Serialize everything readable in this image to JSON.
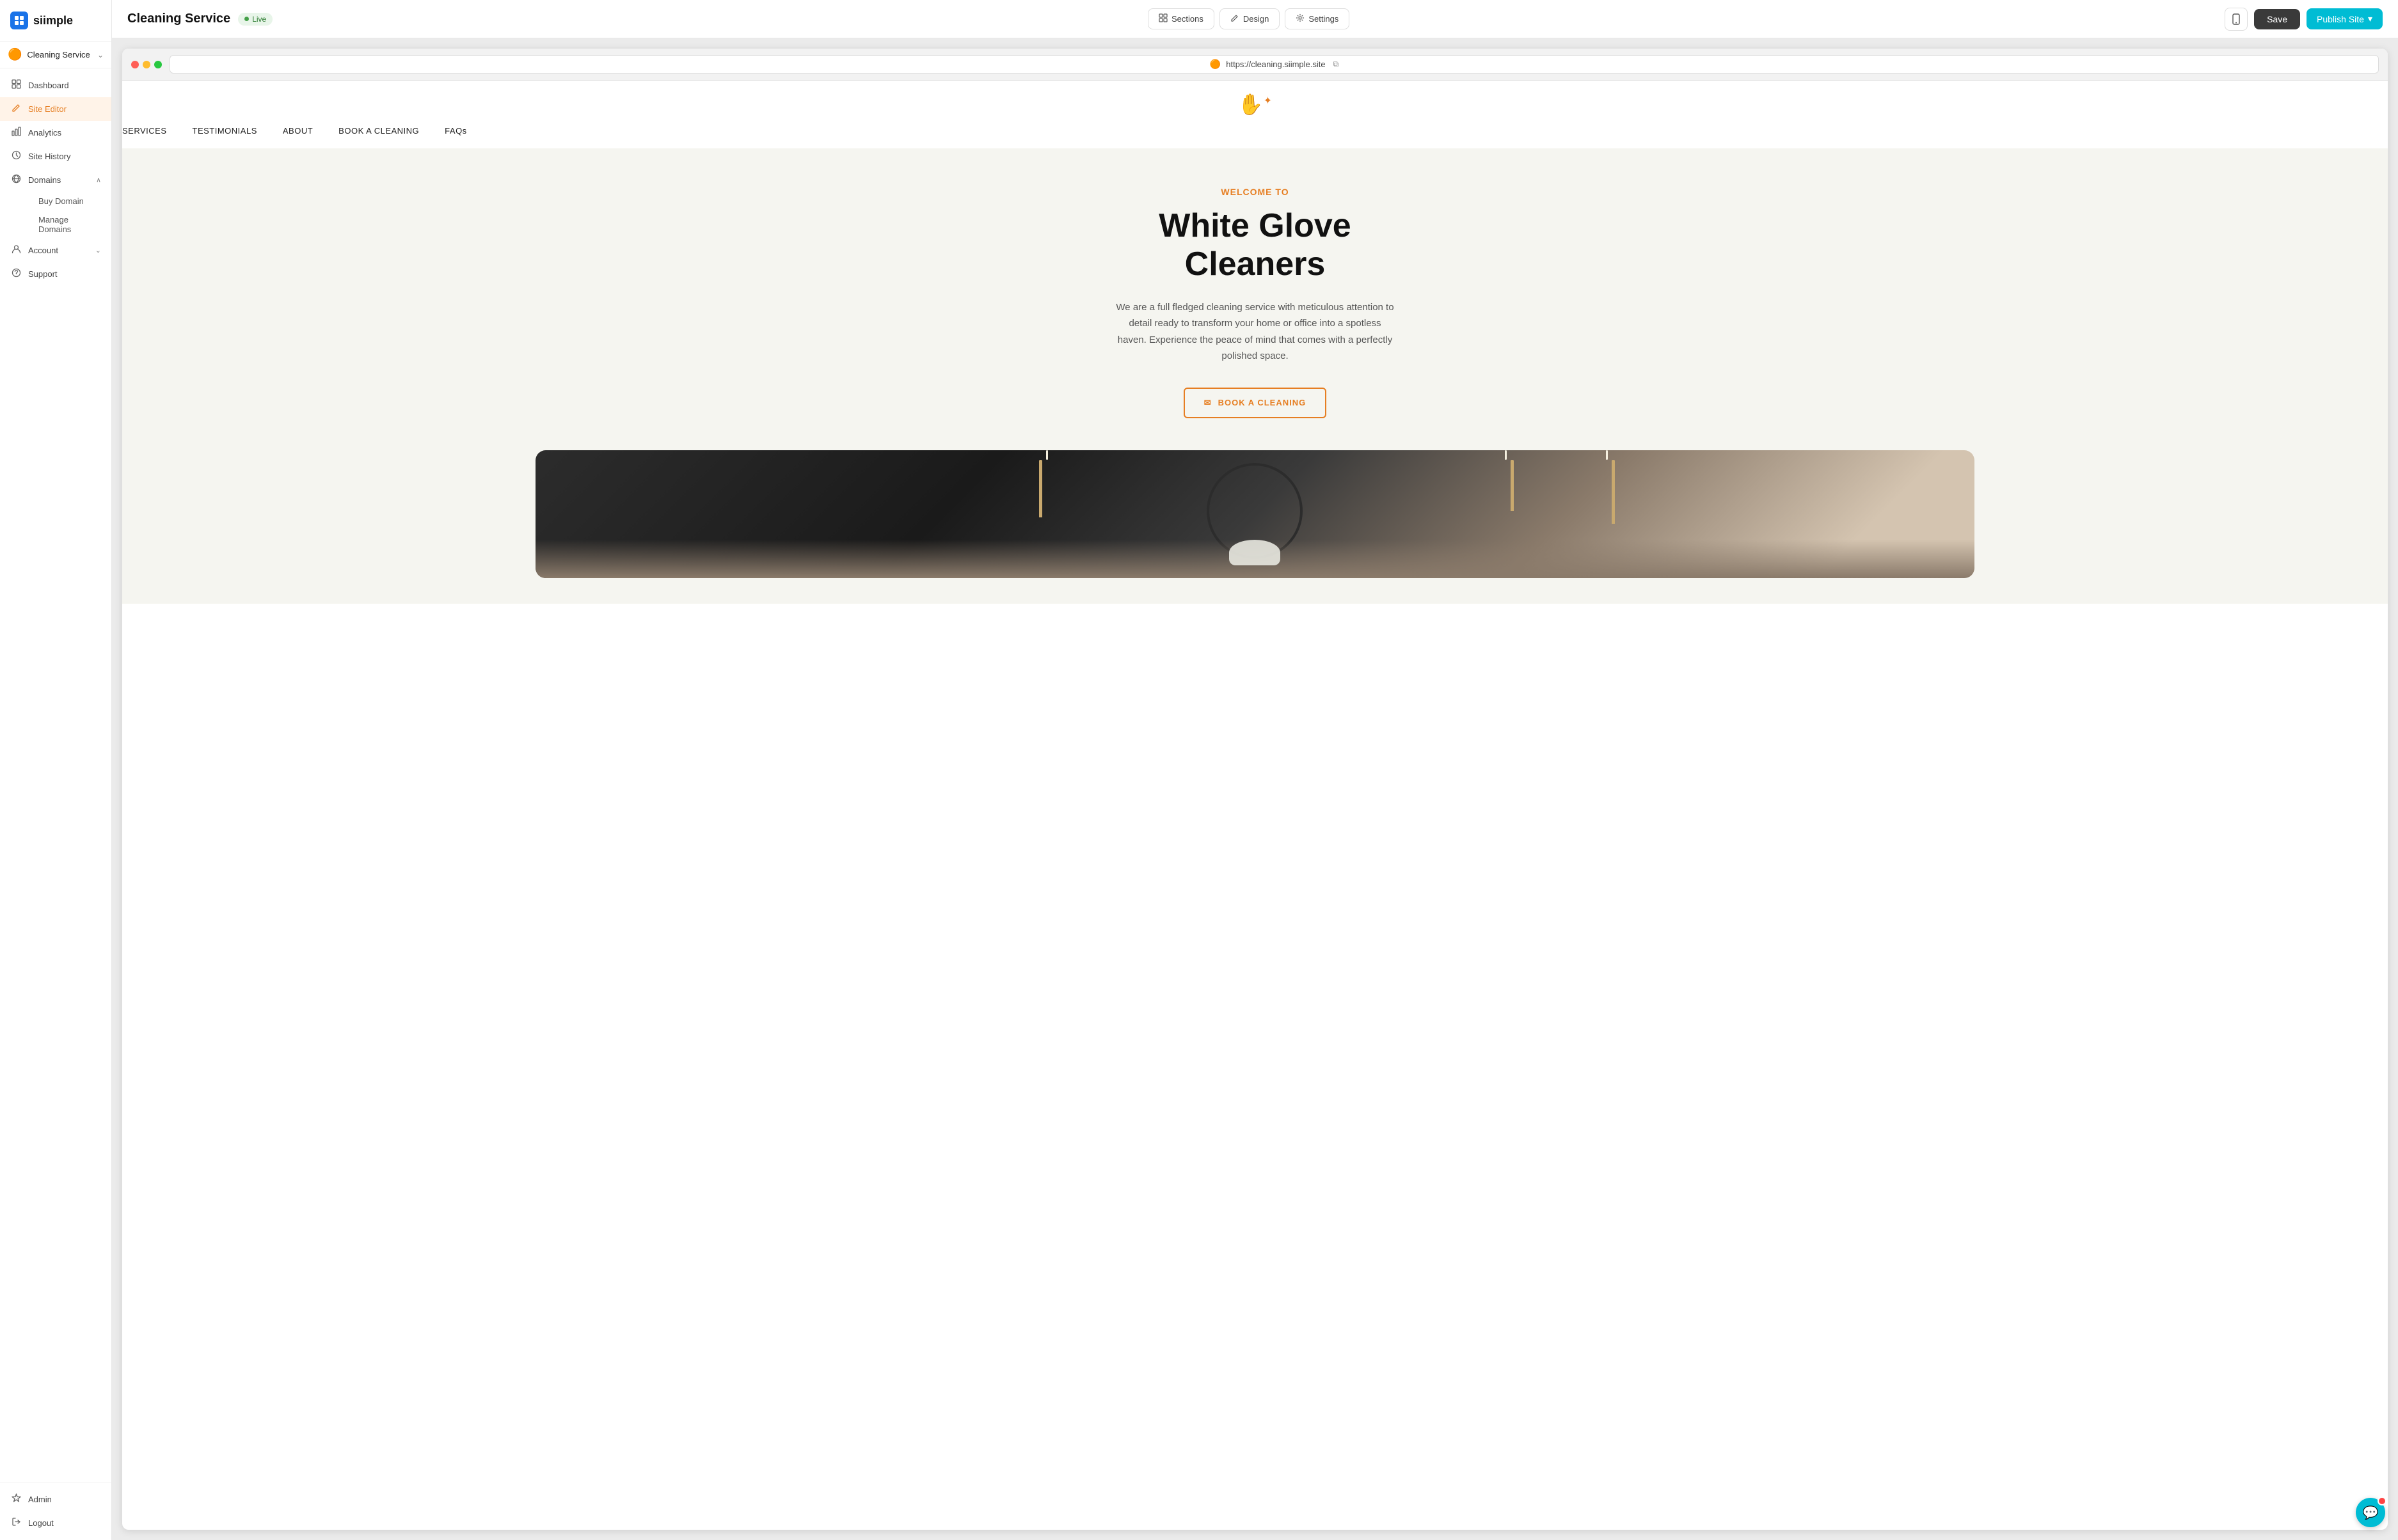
{
  "app": {
    "logo_icon": "▣",
    "logo_text": "siimple"
  },
  "sidebar": {
    "site_icon": "🟠",
    "site_name": "Cleaning Service",
    "chevron": "⌄",
    "nav_items": [
      {
        "id": "dashboard",
        "label": "Dashboard",
        "icon": "⌂",
        "active": false
      },
      {
        "id": "site-editor",
        "label": "Site Editor",
        "icon": "✎",
        "active": true
      },
      {
        "id": "analytics",
        "label": "Analytics",
        "icon": "📊",
        "active": false
      },
      {
        "id": "site-history",
        "label": "Site History",
        "icon": "🕐",
        "active": false
      }
    ],
    "domains": {
      "label": "Domains",
      "icon": "🔗",
      "expanded": true,
      "sub_items": [
        {
          "id": "buy-domain",
          "label": "Buy Domain"
        },
        {
          "id": "manage-domains",
          "label": "Manage Domains"
        }
      ]
    },
    "account": {
      "label": "Account",
      "icon": "👤",
      "expanded": false,
      "chevron": "⌄"
    },
    "support": {
      "label": "Support",
      "icon": "❓"
    },
    "bottom_items": [
      {
        "id": "admin",
        "label": "Admin",
        "icon": "🔑"
      },
      {
        "id": "logout",
        "label": "Logout",
        "icon": "⎋"
      }
    ]
  },
  "topbar": {
    "page_title": "Cleaning Service",
    "live_label": "Live",
    "tabs": [
      {
        "id": "sections",
        "icon": "⊞",
        "label": "Sections"
      },
      {
        "id": "design",
        "icon": "✏",
        "label": "Design"
      },
      {
        "id": "settings",
        "icon": "⚙",
        "label": "Settings"
      }
    ],
    "device_icon": "📱",
    "save_label": "Save",
    "publish_label": "Publish Site",
    "publish_chevron": "▾"
  },
  "browser": {
    "url": "https://cleaning.siimple.site",
    "favicon": "🟠",
    "external_icon": "⬡"
  },
  "site": {
    "logo_icon": "✋",
    "nav_links": [
      {
        "label": "SERVICES"
      },
      {
        "label": "TESTIMONIALS"
      },
      {
        "label": "ABOUT"
      },
      {
        "label": "BOOK A CLEANING"
      },
      {
        "label": "FAQs"
      }
    ],
    "hero": {
      "sparkle_icon": "✋✨",
      "welcome_text": "WELCOME TO",
      "title_line1": "White Glove",
      "title_line2": "Cleaners",
      "subtitle": "We are a full fledged cleaning service with meticulous attention to detail ready to transform your home or office into a spotless haven. Experience the peace of mind that comes with a perfectly polished space.",
      "cta_icon": "✉",
      "cta_label": "BOOK A CLEANING"
    }
  },
  "chat": {
    "icon": "💬"
  }
}
